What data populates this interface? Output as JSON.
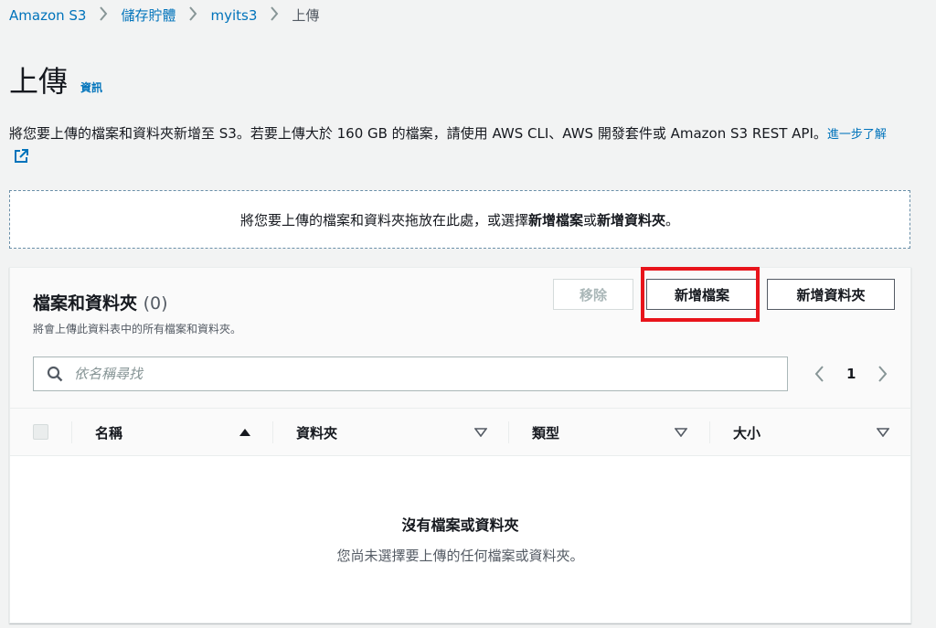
{
  "breadcrumb": {
    "items": [
      "Amazon S3",
      "儲存貯體",
      "myits3"
    ],
    "current": "上傳"
  },
  "header": {
    "title": "上傳",
    "info": "資訊"
  },
  "description": {
    "text": "將您要上傳的檔案和資料夾新增至 S3。若要上傳大於 160 GB 的檔案，請使用 AWS CLI、AWS 開發套件或 Amazon S3 REST API。",
    "learn_more": "進一步了解"
  },
  "dropzone": {
    "prefix": "將您要上傳的檔案和資料夾拖放在此處，或選擇",
    "add_files": "新增檔案",
    "or": "或",
    "add_folder": "新增資料夾",
    "suffix": "。"
  },
  "panel": {
    "title": "檔案和資料夾",
    "count": "(0)",
    "subtitle": "將會上傳此資料表中的所有檔案和資料夾。",
    "buttons": {
      "remove": "移除",
      "add_files": "新增檔案",
      "add_folder": "新增資料夾"
    },
    "search": {
      "placeholder": "依名稱尋找"
    },
    "pagination": {
      "page": "1"
    },
    "columns": [
      "名稱",
      "資料夾",
      "類型",
      "大小"
    ],
    "empty": {
      "title": "沒有檔案或資料夾",
      "subtitle": "您尚未選擇要上傳的任何檔案或資料夾。"
    }
  },
  "colors": {
    "link": "#0073bb",
    "highlight": "#e8141b",
    "background": "#f2f3f3"
  },
  "icons": [
    "chevron-right-icon",
    "external-link-icon",
    "search-icon",
    "chevron-left-icon",
    "sort-ascending-icon",
    "sort-descending-icon"
  ]
}
